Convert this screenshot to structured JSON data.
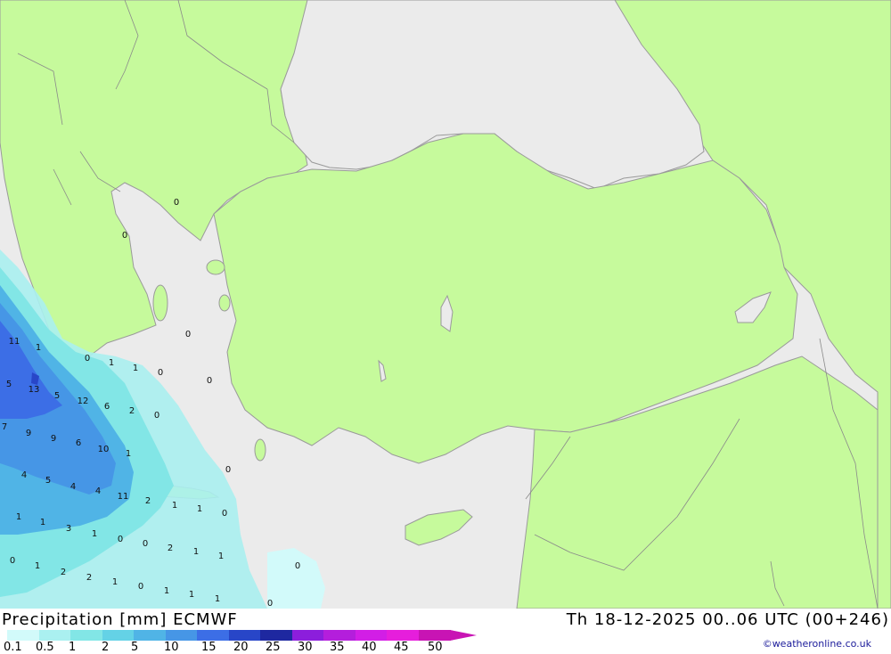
{
  "map": {
    "sea_color": "#ebebeb",
    "land_color": "#c6fa9c",
    "border_color": "#8a8a8a"
  },
  "footer": {
    "title": "Precipitation [mm] ECMWF",
    "datetime": "Th 18-12-2025 00..06 UTC (00+246)",
    "credit": "©weatheronline.co.uk"
  },
  "legend": {
    "labels": [
      "0.1",
      "0.5",
      "1",
      "2",
      "5",
      "10",
      "15",
      "20",
      "25",
      "30",
      "35",
      "40",
      "45",
      "50"
    ],
    "colors": [
      "#d2fafa",
      "#aaf0f0",
      "#82e6e6",
      "#64d2e6",
      "#50b4e6",
      "#4696e6",
      "#3c6ee6",
      "#2846c8",
      "#1e28a0",
      "#8c1edc",
      "#b41edc",
      "#d21ee6",
      "#e61edc",
      "#c814b4"
    ]
  },
  "precip_values": [
    {
      "id": "v1",
      "text": "0"
    },
    {
      "id": "v2",
      "text": "0"
    },
    {
      "id": "v3",
      "text": "11"
    },
    {
      "id": "v4",
      "text": "1"
    },
    {
      "id": "v5",
      "text": "0"
    },
    {
      "id": "v6",
      "text": "1"
    },
    {
      "id": "v7",
      "text": "1"
    },
    {
      "id": "v8",
      "text": "0"
    },
    {
      "id": "v9",
      "text": "0"
    },
    {
      "id": "v10",
      "text": "5"
    },
    {
      "id": "v11",
      "text": "13"
    },
    {
      "id": "v12",
      "text": "5"
    },
    {
      "id": "v13",
      "text": "12"
    },
    {
      "id": "v14",
      "text": "6"
    },
    {
      "id": "v15",
      "text": "2"
    },
    {
      "id": "v16",
      "text": "0"
    },
    {
      "id": "v17",
      "text": "0"
    },
    {
      "id": "v18",
      "text": "7"
    },
    {
      "id": "v19",
      "text": "9"
    },
    {
      "id": "v20",
      "text": "9"
    },
    {
      "id": "v21",
      "text": "6"
    },
    {
      "id": "v22",
      "text": "10"
    },
    {
      "id": "v23",
      "text": "1"
    },
    {
      "id": "v24",
      "text": "4"
    },
    {
      "id": "v25",
      "text": "5"
    },
    {
      "id": "v26",
      "text": "4"
    },
    {
      "id": "v27",
      "text": "4"
    },
    {
      "id": "v28",
      "text": "11"
    },
    {
      "id": "v29",
      "text": "2"
    },
    {
      "id": "v30",
      "text": "1"
    },
    {
      "id": "v31",
      "text": "1"
    },
    {
      "id": "v32",
      "text": "0"
    },
    {
      "id": "v33",
      "text": "0"
    },
    {
      "id": "v34",
      "text": "1"
    },
    {
      "id": "v35",
      "text": "1"
    },
    {
      "id": "v36",
      "text": "3"
    },
    {
      "id": "v37",
      "text": "1"
    },
    {
      "id": "v38",
      "text": "0"
    },
    {
      "id": "v39",
      "text": "0"
    },
    {
      "id": "v40",
      "text": "2"
    },
    {
      "id": "v41",
      "text": "1"
    },
    {
      "id": "v42",
      "text": "1"
    },
    {
      "id": "v43",
      "text": "0"
    },
    {
      "id": "v44",
      "text": "1"
    },
    {
      "id": "v45",
      "text": "2"
    },
    {
      "id": "v46",
      "text": "2"
    },
    {
      "id": "v47",
      "text": "1"
    },
    {
      "id": "v48",
      "text": "0"
    },
    {
      "id": "v49",
      "text": "1"
    },
    {
      "id": "v50",
      "text": "1"
    },
    {
      "id": "v51",
      "text": "1"
    },
    {
      "id": "v52",
      "text": "0"
    },
    {
      "id": "v53",
      "text": "0"
    }
  ]
}
